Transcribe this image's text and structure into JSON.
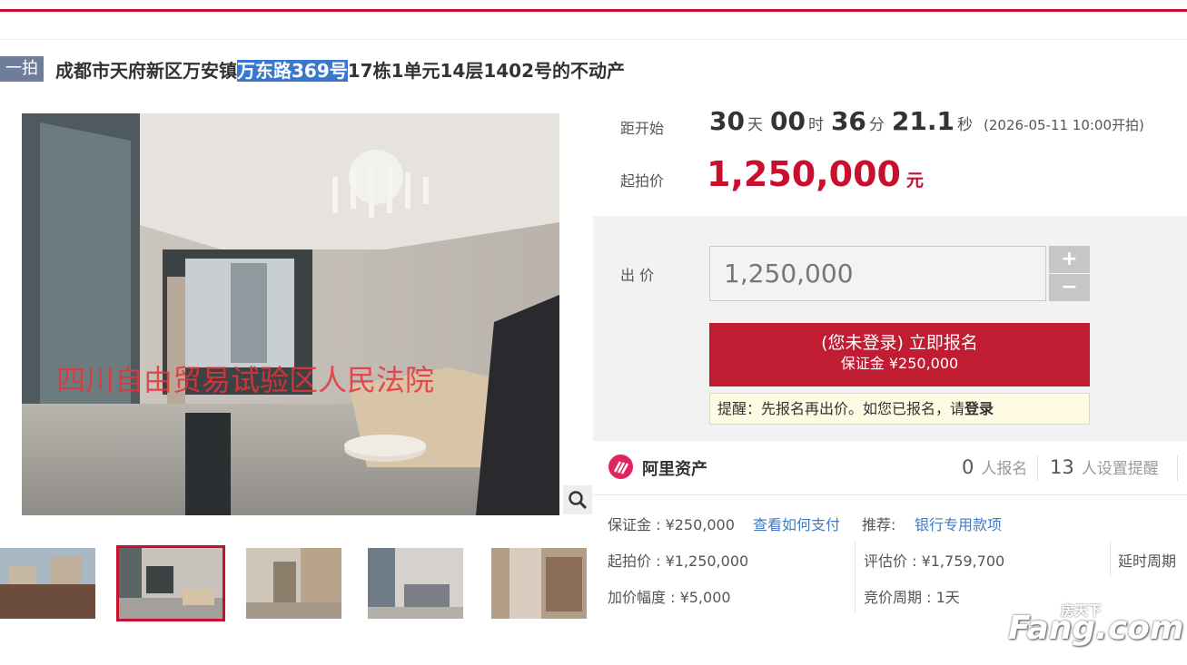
{
  "header": {
    "accent_color": "#c8102e"
  },
  "listing": {
    "tag": "一拍",
    "title_pre": "成都市天府新区万安镇",
    "title_highlight": "万东路369号",
    "title_post": "17栋1单元14层1402号的不动产",
    "image_watermark": "四川自由贸易试验区人民法院"
  },
  "countdown": {
    "label": "距开始",
    "days": "30",
    "days_unit": "天",
    "hours": "00",
    "hours_unit": "时",
    "minutes": "36",
    "minutes_unit": "分",
    "seconds": "21.1",
    "seconds_unit": "秒",
    "start_time": "(2026-05-11 10:00开拍)"
  },
  "start_price": {
    "label": "起拍价",
    "value": "1,250,000",
    "unit": "元"
  },
  "bid": {
    "label": "出 价",
    "input_value": "1,250,000",
    "plus": "+",
    "minus": "−",
    "signup_line1": "(您未登录) 立即报名",
    "signup_line2": "保证金 ¥250,000",
    "notice_text": "提醒：先报名再出价。如您已报名，请",
    "notice_login": "登录"
  },
  "organization": {
    "name": "阿里资产",
    "signup_count": "0",
    "signup_label": "人报名",
    "reminder_count": "13",
    "reminder_label": "人设置提醒"
  },
  "details": {
    "deposit": "保证金 : ¥250,000",
    "how_to_pay": "查看如何支付",
    "recommend_label": "推荐:",
    "recommend_link": "银行专用款项",
    "start_price": "起拍价 : ¥1,250,000",
    "appraisal": "评估价 : ¥1,759,700",
    "delay_period": "延时周期",
    "increment": "加价幅度 : ¥5,000",
    "bidding_period": "竞价周期 : 1天"
  },
  "site_watermark": {
    "top": "房天下",
    "brand": "Fang.com"
  },
  "icons": {
    "zoom": "magnifier-icon",
    "org_logo": "ali-assets-logo-icon"
  }
}
